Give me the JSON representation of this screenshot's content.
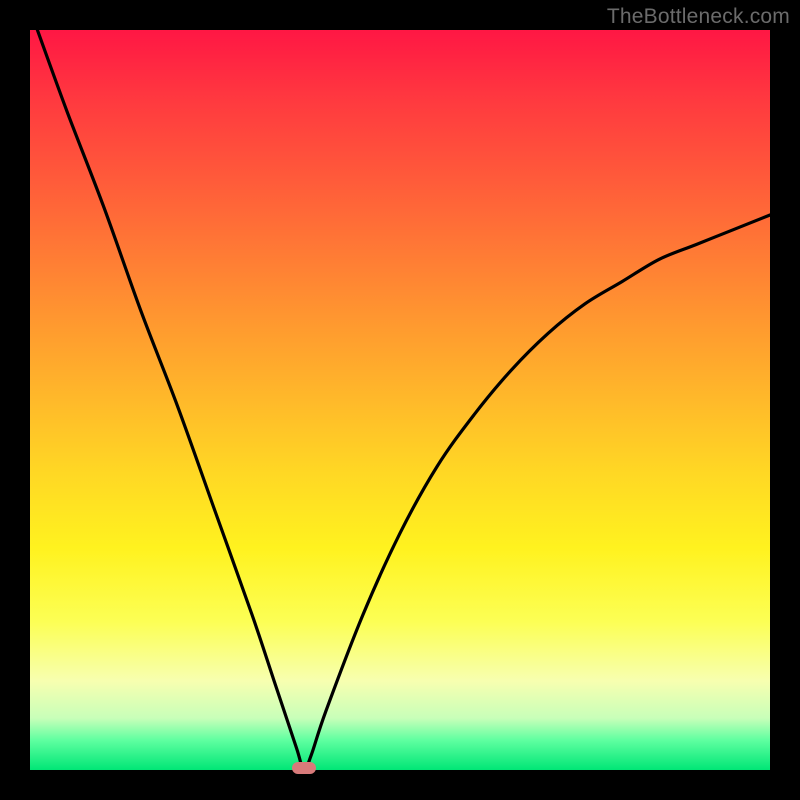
{
  "watermark": {
    "text": "TheBottleneck.com"
  },
  "colors": {
    "frame": "#000000",
    "curve": "#000000",
    "marker": "#d87a7a",
    "gradient_top": "#ff1744",
    "gradient_mid": "#fff21f",
    "gradient_bottom": "#00e676"
  },
  "chart_data": {
    "type": "line",
    "title": "",
    "xlabel": "",
    "ylabel": "",
    "xlim": [
      0,
      100
    ],
    "ylim": [
      0,
      100
    ],
    "grid": false,
    "legend": false,
    "note": "V-shaped bottleneck curve over red→green vertical gradient. Minimum near x≈37. Left branch starts ~(1,100), right branch ends ~(100,~75). Y is estimated bottleneck percentage (100=worst at top, 0=best at bottom).",
    "series": [
      {
        "name": "bottleneck-curve",
        "x": [
          1,
          5,
          10,
          15,
          20,
          25,
          30,
          33,
          36,
          37,
          38,
          40,
          45,
          50,
          55,
          60,
          65,
          70,
          75,
          80,
          85,
          90,
          95,
          100
        ],
        "y": [
          100,
          89,
          76,
          62,
          49,
          35,
          21,
          12,
          3,
          0,
          2,
          8,
          21,
          32,
          41,
          48,
          54,
          59,
          63,
          66,
          69,
          71,
          73,
          75
        ]
      }
    ],
    "marker": {
      "x": 37,
      "y": 0
    }
  }
}
